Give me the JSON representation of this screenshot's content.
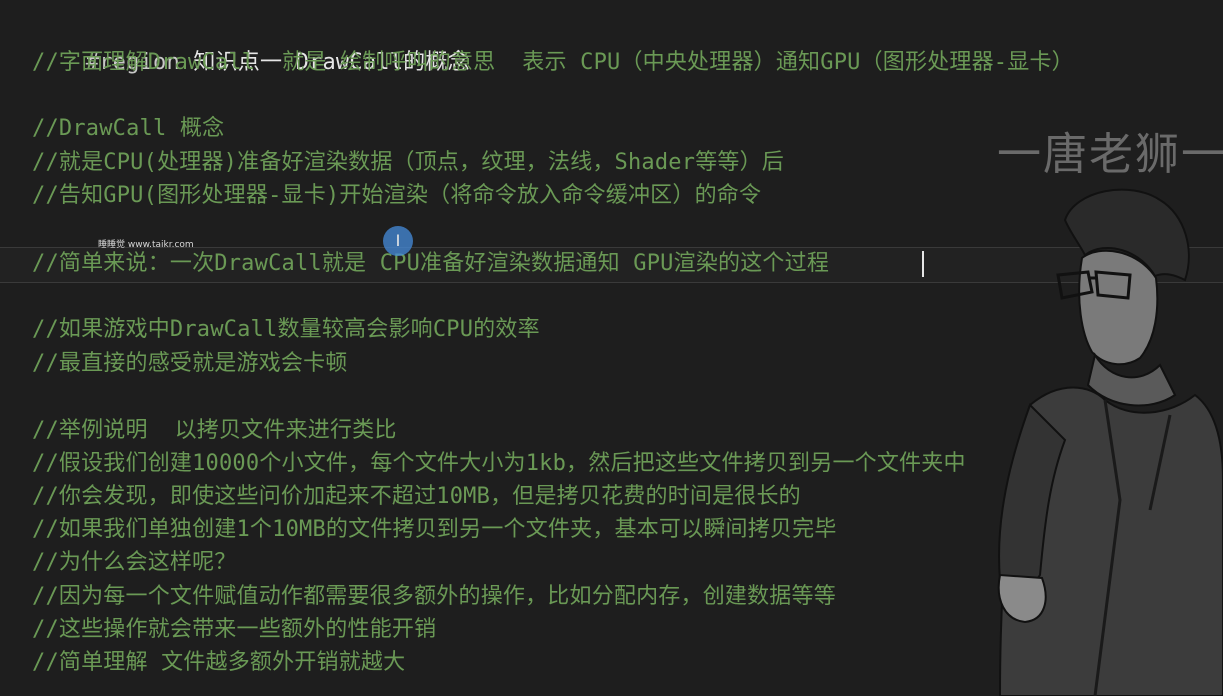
{
  "editor": {
    "lines": [
      {
        "prefix": "#region ",
        "text": "知识点一 DrawCall的概念"
      },
      {
        "text": "//字面理解DrawCall  就是 绘制呼叫的意思  表示 CPU（中央处理器）通知GPU（图形处理器-显卡）"
      },
      {
        "text": ""
      },
      {
        "text": "//DrawCall 概念"
      },
      {
        "text": "//就是CPU(处理器)准备好渲染数据（顶点，纹理，法线，Shader等等）后"
      },
      {
        "text": "//告知GPU(图形处理器-显卡)开始渲染（将命令放入命令缓冲区）的命令"
      },
      {
        "text": ""
      },
      {
        "text": "//简单来说：一次DrawCall就是 CPU准备好渲染数据通知 GPU渲染的这个过程"
      },
      {
        "text": ""
      },
      {
        "text": "//如果游戏中DrawCall数量较高会影响CPU的效率"
      },
      {
        "text": "//最直接的感受就是游戏会卡顿"
      },
      {
        "text": ""
      },
      {
        "text": "//举例说明  以拷贝文件来进行类比"
      },
      {
        "text": "//假设我们创建10000个小文件，每个文件大小为1kb，然后把这些文件拷贝到另一个文件夹中"
      },
      {
        "text": "//你会发现，即使这些问价加起来不超过10MB，但是拷贝花费的时间是很长的"
      },
      {
        "text": "//如果我们单独创建1个10MB的文件拷贝到另一个文件夹，基本可以瞬间拷贝完毕"
      },
      {
        "text": "//为什么会这样呢？"
      },
      {
        "text": "//因为每一个文件赋值动作都需要很多额外的操作，比如分配内存，创建数据等等"
      },
      {
        "text": "//这些操作就会带来一些额外的性能开销"
      },
      {
        "text": "//简单理解 文件越多额外开销就越大"
      }
    ]
  },
  "watermarks": {
    "site": "睡睡觉 www.taikr.com",
    "author": "一唐老狮一"
  },
  "cursor": {
    "glyph": "I"
  },
  "colors": {
    "background": "#1e1e1e",
    "comment": "#6a9955",
    "keyword": "#c8c8c8",
    "caret": "#e6e6e6"
  }
}
